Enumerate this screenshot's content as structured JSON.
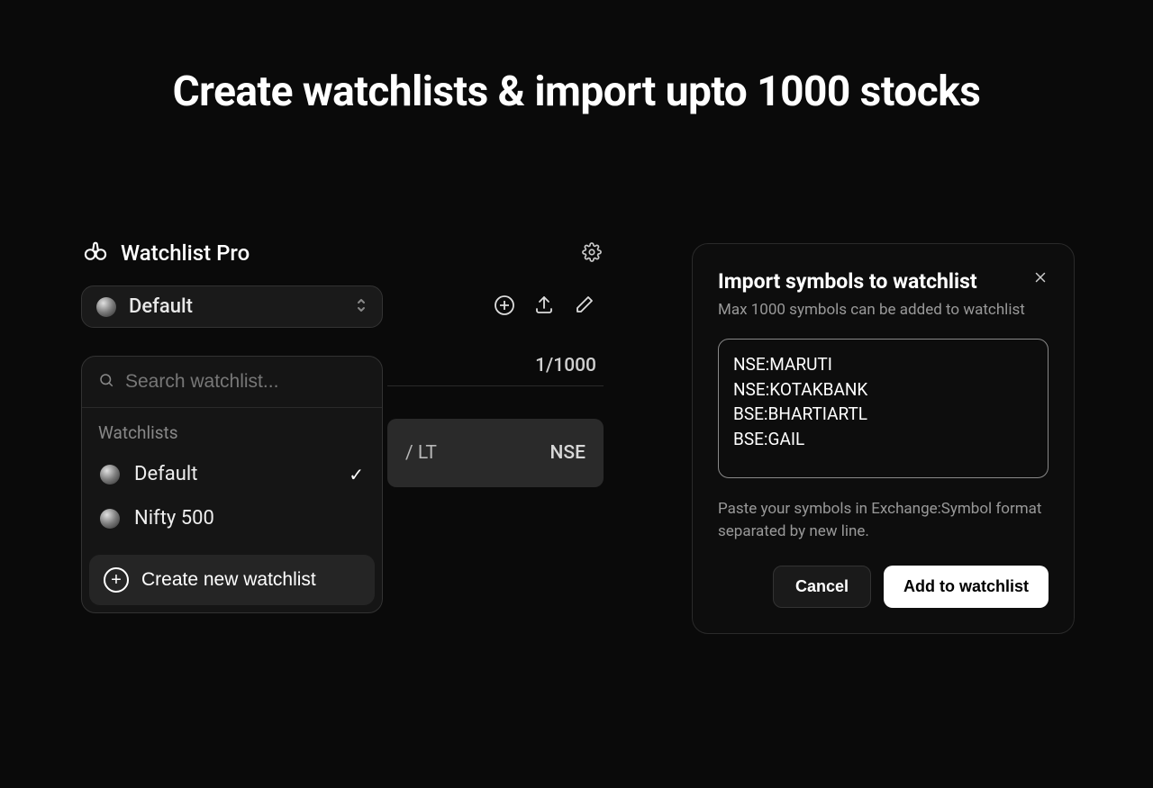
{
  "page": {
    "title": "Create watchlists & import upto 1000 stocks"
  },
  "panel": {
    "title": "Watchlist Pro",
    "selected_watchlist": "Default",
    "counter": "1/1000",
    "search_placeholder": "Search watchlist...",
    "section_label": "Watchlists",
    "items": [
      {
        "label": "Default",
        "checked": true
      },
      {
        "label": "Nifty 500",
        "checked": false
      }
    ],
    "create_label": "Create new watchlist",
    "row_symbol": "/ LT",
    "row_exchange": "NSE"
  },
  "modal": {
    "title": "Import symbols to watchlist",
    "subtitle": "Max 1000 symbols can be added to watchlist",
    "textarea_value": "NSE:MARUTI\nNSE:KOTAKBANK\nBSE:BHARTIARTL\nBSE:GAIL",
    "hint": "Paste your symbols in Exchange:Symbol format separated by new line.",
    "cancel_label": "Cancel",
    "confirm_label": "Add to watchlist"
  }
}
